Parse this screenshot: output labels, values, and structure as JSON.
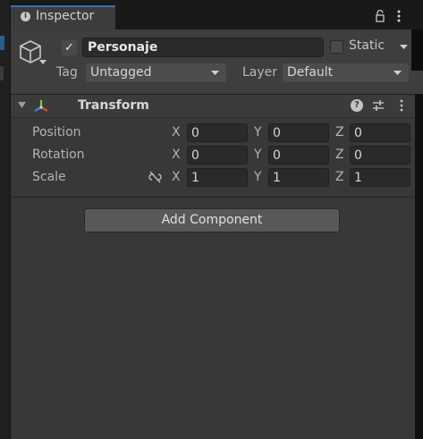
{
  "tab": {
    "title": "Inspector"
  },
  "header": {
    "object_name": "Personaje",
    "active_checked": true,
    "static_label": "Static",
    "tag_label": "Tag",
    "tag_value": "Untagged",
    "layer_label": "Layer",
    "layer_value": "Default"
  },
  "transform": {
    "title": "Transform",
    "rows": [
      {
        "label": "Position",
        "x": "0",
        "y": "0",
        "z": "0"
      },
      {
        "label": "Rotation",
        "x": "0",
        "y": "0",
        "z": "0"
      },
      {
        "label": "Scale",
        "x": "1",
        "y": "1",
        "z": "1"
      }
    ],
    "axes": {
      "x": "X",
      "y": "Y",
      "z": "Z"
    }
  },
  "add_component_label": "Add Component",
  "icons": {
    "tab": "info-icon",
    "lock": "lock-icon",
    "menu": "kebab-menu-icon",
    "object": "cube-icon",
    "transform": "transform-axes-icon",
    "help": "help-icon",
    "presets": "presets-icon",
    "link": "unlinked-chain-icon"
  },
  "colors": {
    "panel": "#383838",
    "header": "#3e3e3e",
    "field": "#2a2a2a",
    "tab_accent": "#3a72b0",
    "axis_red": "#e0403a",
    "axis_green": "#7ec83a",
    "axis_blue": "#3a86e0"
  }
}
